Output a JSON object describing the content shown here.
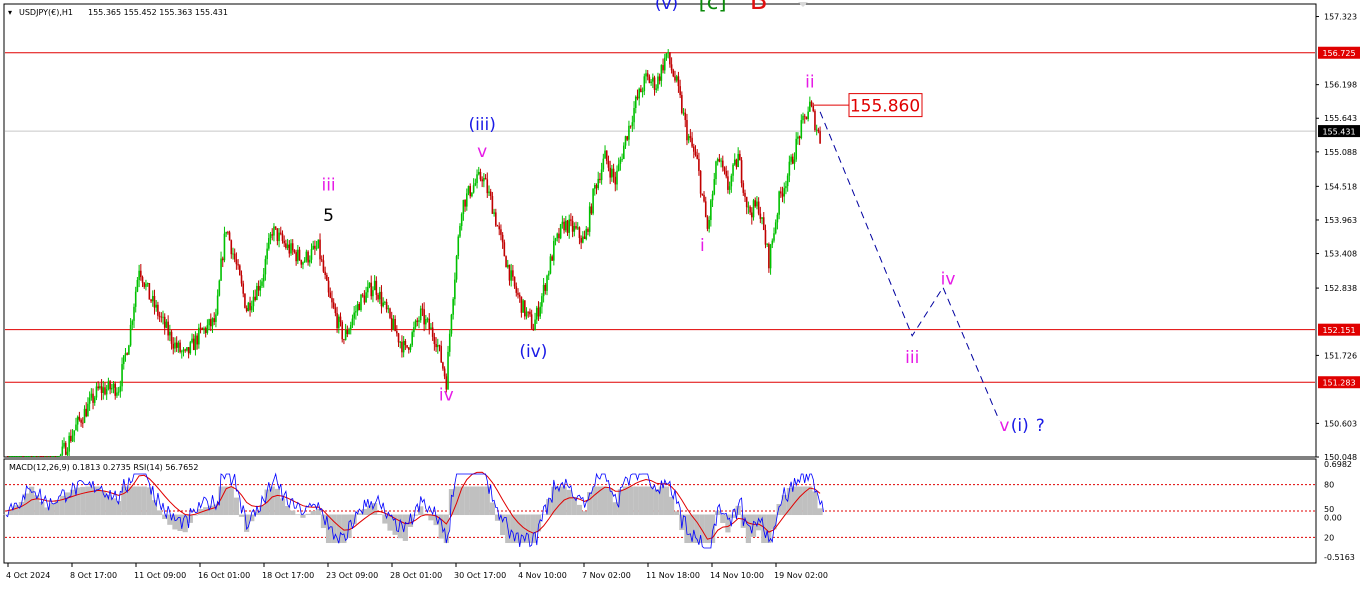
{
  "header": {
    "symbol": "USDJPY(€),H1",
    "ohlc": "155.365 155.452 155.363 155.431",
    "indicator": "MACD(12,26,9) 0.1813 0.2735  RSI(14) 56.7652"
  },
  "colors": {
    "bull": "#00c000",
    "bear": "#c00000",
    "level": "#e00000",
    "projection": "#0000a0",
    "wave_blue": "#1a1ae6",
    "wave_magenta": "#e61ae6",
    "wave_green": "#0a8a0a",
    "wave_red": "#e01010",
    "rsi": "#0000ff",
    "signal": "#e00000",
    "hist": "#c0c0c0"
  },
  "chart_data": {
    "type": "candlestick",
    "x_labels": [
      "4 Oct 2024",
      "8 Oct 17:00",
      "11 Oct 09:00",
      "16 Oct 01:00",
      "18 Oct 17:00",
      "23 Oct 09:00",
      "28 Oct 01:00",
      "30 Oct 17:00",
      "4 Nov 10:00",
      "7 Nov 02:00",
      "11 Nov 18:00",
      "14 Nov 10:00",
      "19 Nov 02:00"
    ],
    "price_ticks": [
      "157.323",
      "156.198",
      "155.643",
      "155.088",
      "154.518",
      "153.963",
      "153.408",
      "152.838",
      "151.726",
      "150.603",
      "150.048"
    ],
    "ylim": [
      150.048,
      157.53
    ],
    "price_path": [
      [
        0,
        149.05
      ],
      [
        3,
        149.4
      ],
      [
        5,
        149.9
      ],
      [
        8,
        149.7
      ],
      [
        10,
        149.95
      ],
      [
        14,
        150.6
      ],
      [
        18,
        151.15
      ],
      [
        22,
        151.2
      ],
      [
        24,
        152.0
      ],
      [
        26,
        153.2
      ],
      [
        28,
        152.7
      ],
      [
        31,
        152.2
      ],
      [
        33,
        151.9
      ],
      [
        35,
        151.7
      ],
      [
        38,
        152.1
      ],
      [
        41,
        152.3
      ],
      [
        42,
        153.2
      ],
      [
        43,
        153.85
      ],
      [
        45,
        153.2
      ],
      [
        47,
        152.5
      ],
      [
        50,
        153.0
      ],
      [
        52,
        153.8
      ],
      [
        55,
        153.5
      ],
      [
        58,
        153.3
      ],
      [
        61,
        153.5
      ],
      [
        63,
        152.7
      ],
      [
        66,
        152.0
      ],
      [
        69,
        152.6
      ],
      [
        72,
        152.9
      ],
      [
        75,
        152.3
      ],
      [
        78,
        151.8
      ],
      [
        81,
        152.4
      ],
      [
        84,
        152.0
      ],
      [
        86,
        151.3
      ],
      [
        87,
        152.5
      ],
      [
        89,
        154.2
      ],
      [
        91,
        154.5
      ],
      [
        93,
        154.7
      ],
      [
        95,
        154.2
      ],
      [
        97,
        153.5
      ],
      [
        99,
        152.9
      ],
      [
        101,
        152.5
      ],
      [
        103,
        152.2
      ],
      [
        105,
        152.8
      ],
      [
        107,
        153.5
      ],
      [
        109,
        153.9
      ],
      [
        111,
        153.8
      ],
      [
        113,
        153.6
      ],
      [
        115,
        154.5
      ],
      [
        117,
        155.0
      ],
      [
        119,
        154.6
      ],
      [
        121,
        155.3
      ],
      [
        123,
        155.9
      ],
      [
        125,
        156.3
      ],
      [
        127,
        156.2
      ],
      [
        129,
        156.7
      ],
      [
        131,
        156.2
      ],
      [
        133,
        155.4
      ],
      [
        135,
        154.9
      ],
      [
        137,
        153.8
      ],
      [
        139,
        155.0
      ],
      [
        141,
        154.5
      ],
      [
        143,
        155.0
      ],
      [
        145,
        154.1
      ],
      [
        147,
        154.2
      ],
      [
        149,
        153.3
      ],
      [
        151,
        154.3
      ],
      [
        153,
        154.8
      ],
      [
        155,
        155.4
      ],
      [
        157,
        155.86
      ],
      [
        159,
        155.3
      ]
    ],
    "levels": [
      {
        "label": "156.725",
        "value": 156.725
      },
      {
        "label": "152.151",
        "value": 152.151
      },
      {
        "label": "151.283",
        "value": 151.283
      }
    ],
    "current_price": {
      "label": "155.431",
      "value": 155.431
    },
    "annotation_price": {
      "label": "155.860",
      "value": 155.86
    },
    "projection": [
      [
        159,
        155.75
      ],
      [
        177,
        152.05
      ],
      [
        183,
        152.85
      ],
      [
        194,
        150.65
      ]
    ],
    "projection_time": {
      "index": 159,
      "label": "19 Nov 02:00"
    },
    "wave_labels": [
      {
        "text": "(v)",
        "color": "wave_blue",
        "i": 129,
        "p": 157.45
      },
      {
        "text": "[c]",
        "color": "wave_green",
        "i": 138,
        "p": 157.45
      },
      {
        "text": "B",
        "color": "wave_red",
        "i": 147,
        "p": 157.45
      },
      {
        "text": "ii",
        "color": "wave_magenta",
        "i": 157,
        "p": 156.15
      },
      {
        "text": "(iii)",
        "color": "wave_blue",
        "i": 93,
        "p": 155.45
      },
      {
        "text": "v",
        "color": "wave_magenta",
        "i": 93,
        "p": 155.0
      },
      {
        "text": "iii",
        "color": "wave_magenta",
        "i": 63,
        "p": 154.45
      },
      {
        "text": "5",
        "color": "black",
        "i": 63,
        "p": 153.95
      },
      {
        "text": "i",
        "color": "wave_magenta",
        "i": 136,
        "p": 153.45
      },
      {
        "text": "iv",
        "color": "wave_magenta",
        "i": 184,
        "p": 152.9
      },
      {
        "text": "(iv)",
        "color": "wave_blue",
        "i": 103,
        "p": 151.7
      },
      {
        "text": "iii",
        "color": "wave_magenta",
        "i": 177,
        "p": 151.6
      },
      {
        "text": "iv",
        "color": "wave_magenta",
        "i": 86,
        "p": 150.98
      },
      {
        "text": "v",
        "color": "wave_magenta",
        "i": 195,
        "p": 150.48
      },
      {
        "text": "(i)",
        "color": "wave_blue",
        "i": 198,
        "p": 150.48
      },
      {
        "text": "?",
        "color": "wave_blue",
        "i": 202,
        "p": 150.48
      }
    ],
    "indicator": {
      "macd_ticks": [
        "0.6982",
        "0.00",
        "-0.5163"
      ],
      "rsi_ticks": [
        "80",
        "50",
        "20"
      ],
      "macd_range": [
        -0.5163,
        0.6982
      ],
      "rsi_levels": [
        80,
        50,
        20
      ]
    }
  }
}
